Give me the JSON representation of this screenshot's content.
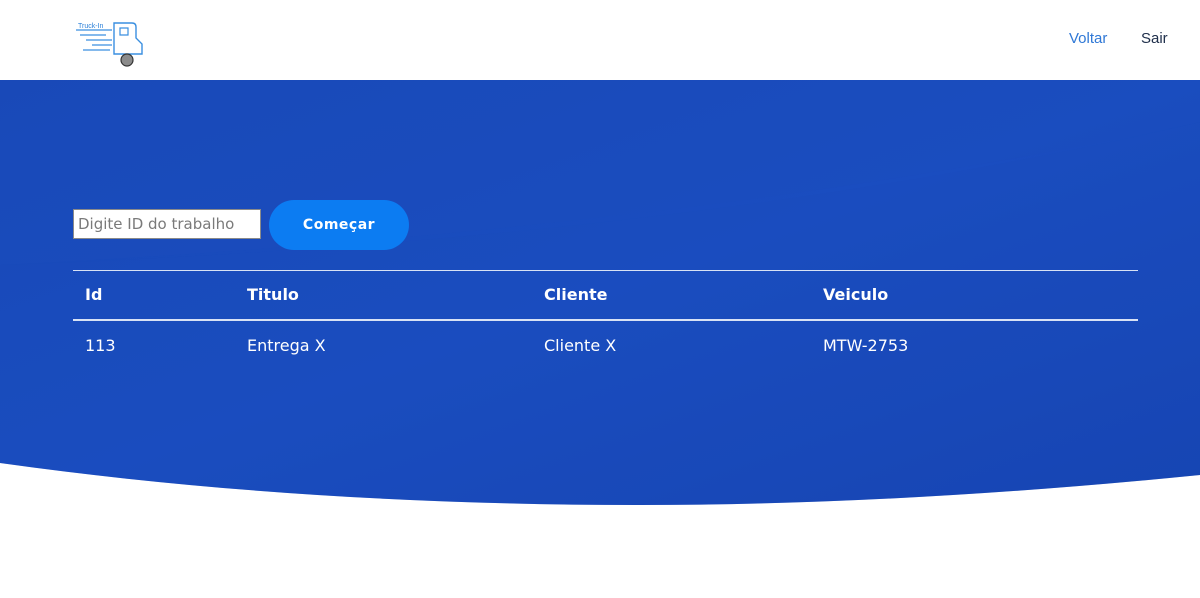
{
  "header": {
    "logo_text": "Truck-In",
    "nav": {
      "back_label": "Voltar",
      "logout_label": "Sair"
    }
  },
  "search": {
    "placeholder": "Digite ID do trabalho",
    "value": "",
    "start_label": "Começar"
  },
  "table": {
    "columns": [
      "Id",
      "Titulo",
      "Cliente",
      "Veiculo"
    ],
    "rows": [
      [
        "113",
        "Entrega X",
        "Cliente X",
        "MTW-2753"
      ]
    ]
  },
  "colors": {
    "hero_blue": "#1747b3",
    "hero_blue_light": "#1d4fc0",
    "button_blue": "#0c7cf2",
    "link_blue": "#2f78d6",
    "link_dark": "#1e2e4a"
  }
}
